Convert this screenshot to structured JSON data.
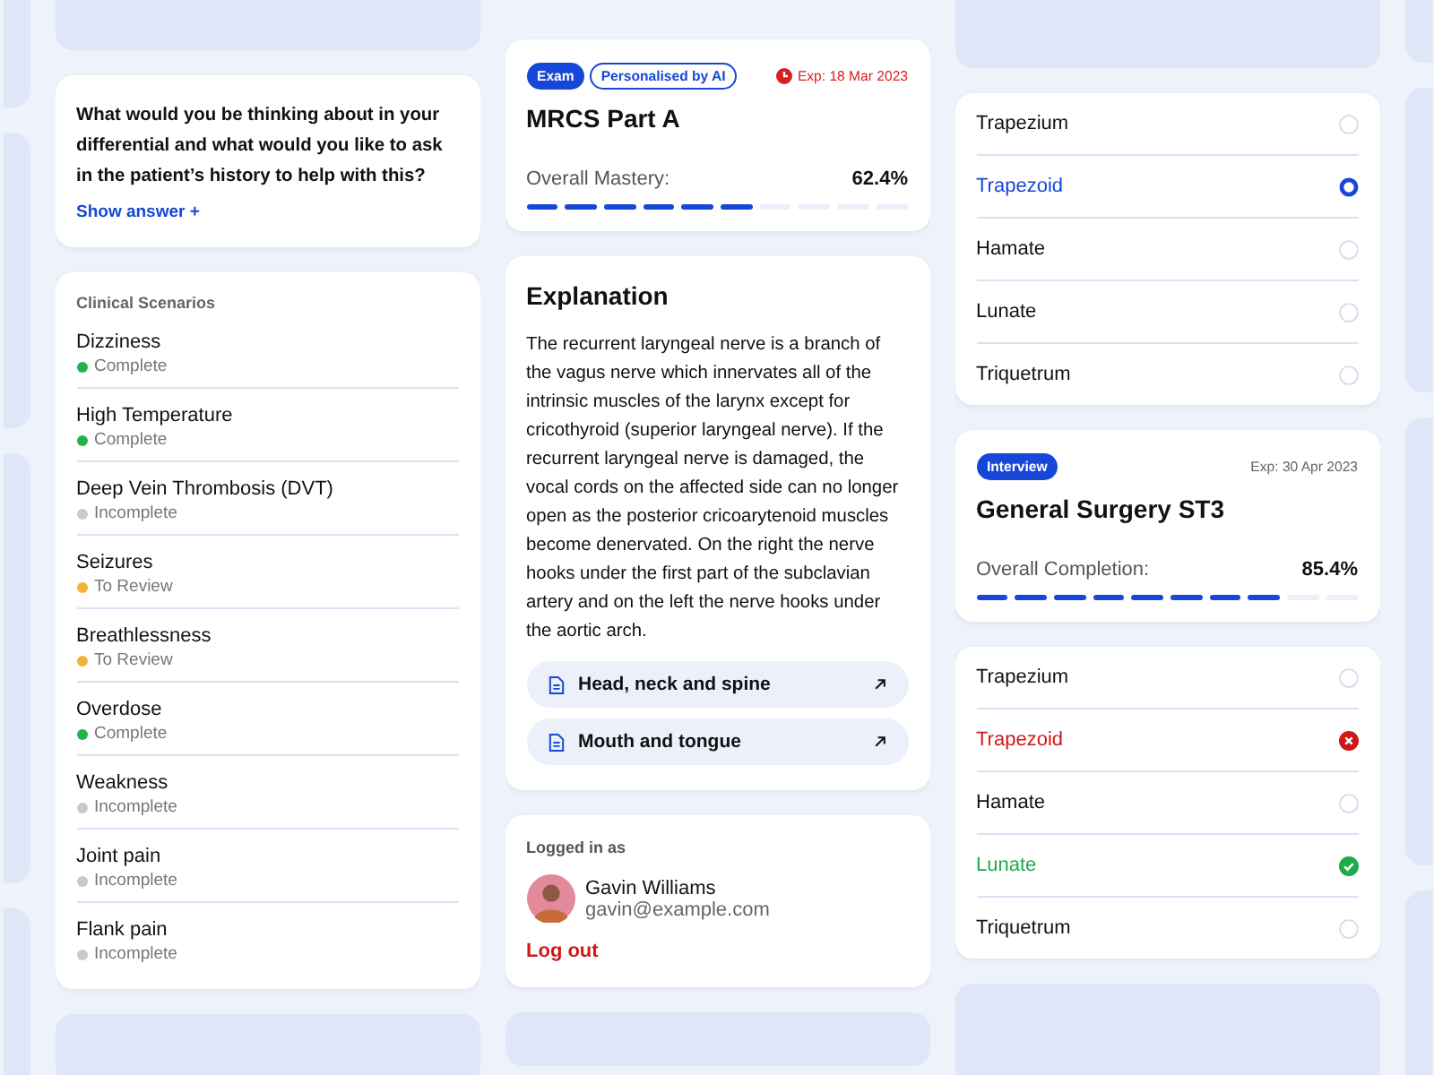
{
  "question": {
    "text": "What would you be thinking about in your differential and what would you like to ask in the patient’s history to help with this?",
    "link": "Show answer",
    "link_icon": "+"
  },
  "scenarios": {
    "heading": "Clinical Scenarios",
    "items": [
      {
        "title": "Dizziness",
        "status": "Complete",
        "color": "#22b24c"
      },
      {
        "title": "High Temperature",
        "status": "Complete",
        "color": "#22b24c"
      },
      {
        "title": "Deep Vein Thrombosis (DVT)",
        "status": "Incomplete",
        "color": "#c8cad0"
      },
      {
        "title": "Seizures",
        "status": "To Review",
        "color": "#f5b335"
      },
      {
        "title": "Breathlessness",
        "status": "To Review",
        "color": "#f5b335"
      },
      {
        "title": "Overdose",
        "status": "Complete",
        "color": "#22b24c"
      },
      {
        "title": "Weakness",
        "status": "Incomplete",
        "color": "#c8cad0"
      },
      {
        "title": "Joint pain",
        "status": "Incomplete",
        "color": "#c8cad0"
      },
      {
        "title": "Flank pain",
        "status": "Incomplete",
        "color": "#c8cad0"
      }
    ]
  },
  "courses": [
    {
      "tags": [
        {
          "label": "Exam",
          "kind": "solid"
        },
        {
          "label": "Personalised by AI",
          "kind": "outline"
        }
      ],
      "expiry": "Exp: 18 Mar 2023",
      "expiry_urgent": true,
      "title": "MRCS Part A",
      "progress_label": "Overall Mastery:",
      "progress_value": "62.4%",
      "level": 0.624
    },
    {
      "tags": [
        {
          "label": "Interview",
          "kind": "solid"
        }
      ],
      "expiry": "Exp: 30 Apr 2023",
      "expiry_urgent": false,
      "title": "General Surgery ST3",
      "progress_label": "Overall Completion:",
      "progress_value": "85.4%",
      "level": 0.854
    }
  ],
  "explanation": {
    "title": "Explanation",
    "text": "The recurrent laryngeal nerve is a branch of the vagus nerve which innervates all of the intrinsic muscles of the larynx except for cricothyroid (superior laryngeal nerve). If the recurrent laryngeal nerve is damaged, the vocal cords on the affected side can no longer open as the posterior cricoarytenoid muscles become denervated. On the right the nerve hooks under the first part of the subclavian artery and on the left the nerve hooks under the aortic arch.",
    "links": [
      "Head, neck and spine",
      "Mouth and tongue"
    ]
  },
  "account": {
    "label": "Logged in as",
    "name": "Gavin Williams",
    "email": "gavin@example.com",
    "logout": "Log out"
  },
  "quizzes": [
    {
      "options": [
        {
          "label": "Trapezium",
          "kind": "plain"
        },
        {
          "label": "Trapezoid",
          "kind": "selected"
        },
        {
          "label": "Hamate",
          "kind": "plain"
        },
        {
          "label": "Lunate",
          "kind": "plain"
        },
        {
          "label": "Triquetrum",
          "kind": "plain"
        }
      ]
    },
    {
      "options": [
        {
          "label": "Trapezium",
          "kind": "plain"
        },
        {
          "label": "Trapezoid",
          "kind": "wrong"
        },
        {
          "label": "Hamate",
          "kind": "plain"
        },
        {
          "label": "Lunate",
          "kind": "correct"
        },
        {
          "label": "Triquetrum",
          "kind": "plain"
        }
      ]
    }
  ]
}
